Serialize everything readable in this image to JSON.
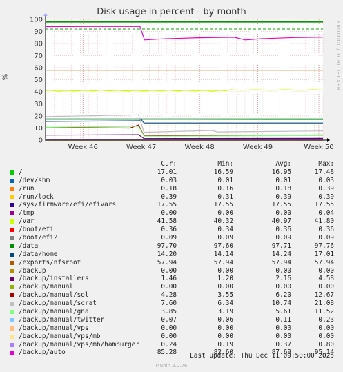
{
  "chart_data": {
    "type": "line",
    "title": "Disk usage in percent - by month",
    "ylabel": "%",
    "side_text": "RRDTOOL / TOBI OETIKER",
    "ylim": [
      0,
      100
    ],
    "yticks": [
      "0",
      "10",
      "20",
      "30",
      "40",
      "50",
      "60",
      "70",
      "80",
      "90",
      "100"
    ],
    "xticks": [
      "Week 46",
      "Week 47",
      "Week 48",
      "Week 49",
      "Week 50"
    ],
    "grid": true,
    "thresholds": [
      {
        "value": 92,
        "color": "#00aa00"
      },
      {
        "value": 98,
        "color": "#00aa00"
      }
    ],
    "columns": [
      "Cur:",
      "Min:",
      "Avg:",
      "Max:"
    ],
    "series": [
      {
        "name": "/",
        "color": "#00cc00",
        "cur": "17.01",
        "min": "16.59",
        "avg": "16.95",
        "max": "17.48"
      },
      {
        "name": "/dev/shm",
        "color": "#0066b3",
        "cur": "0.03",
        "min": "0.01",
        "avg": "0.01",
        "max": "0.03"
      },
      {
        "name": "/run",
        "color": "#ff8000",
        "cur": "0.18",
        "min": "0.16",
        "avg": "0.18",
        "max": "0.39"
      },
      {
        "name": "/run/lock",
        "color": "#ffcc00",
        "cur": "0.39",
        "min": "0.31",
        "avg": "0.39",
        "max": "0.39"
      },
      {
        "name": "/sys/firmware/efi/efivars",
        "color": "#330099",
        "cur": "17.55",
        "min": "17.55",
        "avg": "17.55",
        "max": "17.55"
      },
      {
        "name": "/tmp",
        "color": "#990099",
        "cur": "0.00",
        "min": "0.00",
        "avg": "0.00",
        "max": "0.04"
      },
      {
        "name": "/var",
        "color": "#ccff00",
        "cur": "41.58",
        "min": "40.32",
        "avg": "40.97",
        "max": "41.80"
      },
      {
        "name": "/boot/efi",
        "color": "#ff0000",
        "cur": "0.36",
        "min": "0.34",
        "avg": "0.36",
        "max": "0.36"
      },
      {
        "name": "/boot/efi2",
        "color": "#808080",
        "cur": "0.09",
        "min": "0.09",
        "avg": "0.09",
        "max": "0.09"
      },
      {
        "name": "/data",
        "color": "#008f00",
        "cur": "97.70",
        "min": "97.60",
        "avg": "97.71",
        "max": "97.76"
      },
      {
        "name": "/data/home",
        "color": "#00487d",
        "cur": "14.20",
        "min": "14.14",
        "avg": "14.24",
        "max": "17.01"
      },
      {
        "name": "/exports/nfsroot",
        "color": "#b35a00",
        "cur": "57.94",
        "min": "57.94",
        "avg": "57.94",
        "max": "57.94"
      },
      {
        "name": "/backup",
        "color": "#b38f00",
        "cur": "0.00",
        "min": "0.00",
        "avg": "0.00",
        "max": "0.00"
      },
      {
        "name": "/backup/installers",
        "color": "#6b006b",
        "cur": "1.46",
        "min": "1.20",
        "avg": "2.16",
        "max": "4.58"
      },
      {
        "name": "/backup/manual",
        "color": "#8fb300",
        "cur": "0.00",
        "min": "0.00",
        "avg": "0.00",
        "max": "0.00"
      },
      {
        "name": "/backup/manual/sol",
        "color": "#b30000",
        "cur": "4.28",
        "min": "3.55",
        "avg": "6.20",
        "max": "12.67"
      },
      {
        "name": "/backup/manual/scrat",
        "color": "#bebebe",
        "cur": "7.60",
        "min": "6.34",
        "avg": "10.74",
        "max": "21.08"
      },
      {
        "name": "/backup/manual/gna",
        "color": "#80ff80",
        "cur": "3.85",
        "min": "3.19",
        "avg": "5.61",
        "max": "11.52"
      },
      {
        "name": "/backup/manual/twitter",
        "color": "#80c9ff",
        "cur": "0.07",
        "min": "0.06",
        "avg": "0.11",
        "max": "0.23"
      },
      {
        "name": "/backup/manual/vps",
        "color": "#ffc080",
        "cur": "0.00",
        "min": "0.00",
        "avg": "0.00",
        "max": "0.00"
      },
      {
        "name": "/backup/manual/vps/mb",
        "color": "#ffe680",
        "cur": "0.00",
        "min": "0.00",
        "avg": "0.00",
        "max": "0.00"
      },
      {
        "name": "/backup/manual/vps/mb/hamburger",
        "color": "#aa80ff",
        "cur": "0.24",
        "min": "0.19",
        "avg": "0.37",
        "max": "0.80"
      },
      {
        "name": "/backup/auto",
        "color": "#ee00cc",
        "cur": "85.28",
        "min": "82.60",
        "avg": "87.69",
        "max": "95.14"
      }
    ]
  },
  "last_update": "Last update: Thu Dec 11 09:50:00 2025",
  "footer": "Munin 2.0.76"
}
